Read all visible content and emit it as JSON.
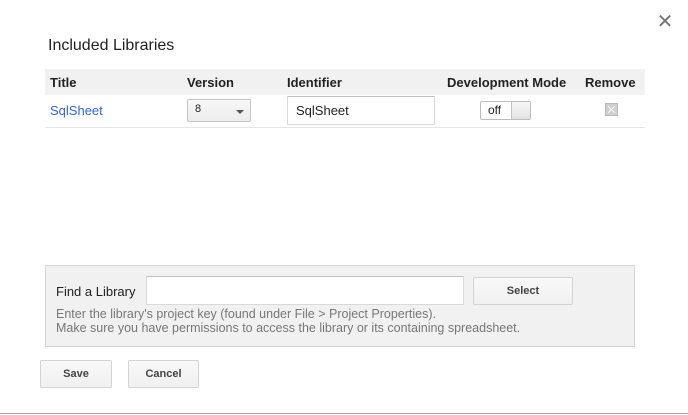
{
  "dialog": {
    "title": "Included Libraries",
    "close_icon": "close-icon"
  },
  "table": {
    "headers": {
      "title": "Title",
      "version": "Version",
      "identifier": "Identifier",
      "dev_mode": "Development Mode",
      "remove": "Remove"
    },
    "rows": [
      {
        "title": "SqlSheet",
        "version": "8",
        "identifier": "SqlSheet",
        "dev_mode": "off"
      }
    ]
  },
  "find": {
    "label": "Find a Library",
    "input_value": "",
    "select_label": "Select",
    "hint_line1": "Enter the library's project key (found under File > Project Properties).",
    "hint_line2": "Make sure you have permissions to access the library or its containing spreadsheet."
  },
  "actions": {
    "save_label": "Save",
    "cancel_label": "Cancel"
  }
}
